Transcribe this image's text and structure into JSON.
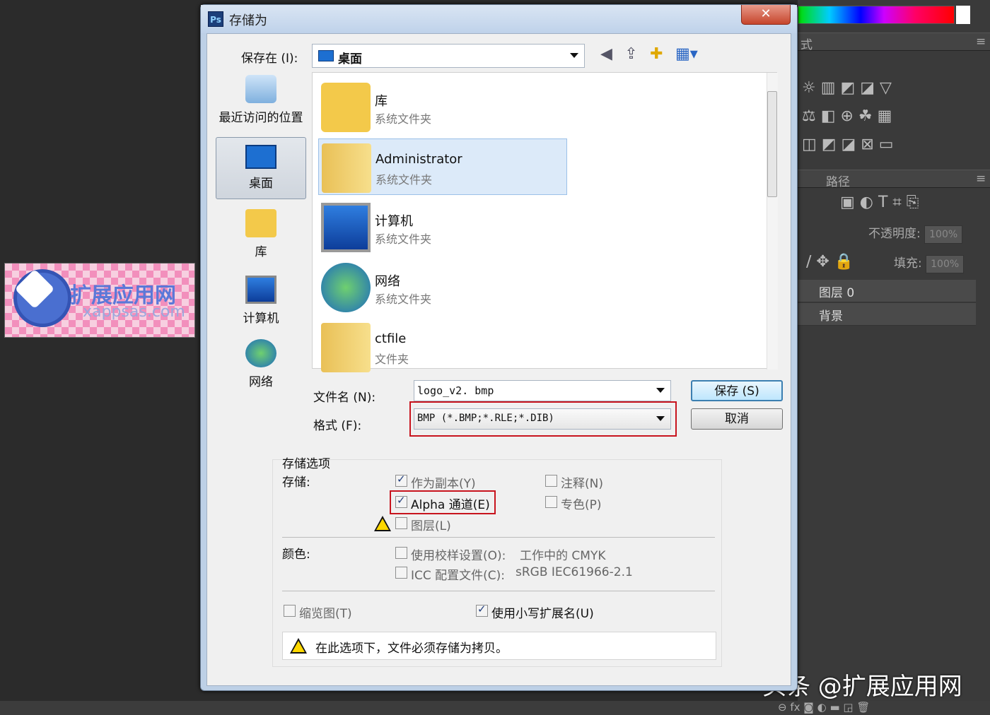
{
  "dialog": {
    "app_badge": "Ps",
    "title": "存储为",
    "close_label": "✕"
  },
  "save_in": {
    "label": "保存在 (I):",
    "value": "桌面"
  },
  "places": [
    {
      "label": "最近访问的位置"
    },
    {
      "label": "桌面"
    },
    {
      "label": "库"
    },
    {
      "label": "计算机"
    },
    {
      "label": "网络"
    }
  ],
  "files": [
    {
      "name": "库",
      "type": "系统文件夹"
    },
    {
      "name": "Administrator",
      "type": "系统文件夹"
    },
    {
      "name": "计算机",
      "type": "系统文件夹"
    },
    {
      "name": "网络",
      "type": "系统文件夹"
    },
    {
      "name": "ctfile",
      "type": "文件夹"
    }
  ],
  "filename": {
    "label": "文件名 (N):",
    "value": "logo_v2. bmp"
  },
  "format": {
    "label": "格式 (F):",
    "value": "BMP  (*.BMP;*.RLE;*.DIB)"
  },
  "buttons": {
    "save": "保存 (S)",
    "cancel": "取消"
  },
  "options": {
    "group_title": "存储选项",
    "store_label": "存储:",
    "as_copy": "作为副本(Y)",
    "notes": "注释(N)",
    "alpha": "Alpha 通道(E)",
    "spot": "专色(P)",
    "layers": "图层(L)",
    "color_label": "颜色:",
    "proof_label": "使用校样设置(O):",
    "proof_value": "工作中的 CMYK",
    "icc_label": "ICC 配置文件(C):",
    "icc_value": "sRGB IEC61966-2.1",
    "thumbnail": "缩览图(T)",
    "lowercase_ext": "使用小写扩展名(U)",
    "notice": "在此选项下，文件必须存储为拷贝。"
  },
  "checkboxes": {
    "as_copy": true,
    "notes": false,
    "alpha": true,
    "spot": false,
    "layers": false,
    "proof": false,
    "icc": false,
    "thumbnail": false,
    "lowercase_ext": true
  },
  "photoshop": {
    "tab_style_fragment": "式",
    "tab_paths": "路径",
    "opacity_label": "不透明度:",
    "opacity_value": "100%",
    "fill_label": "填充:",
    "fill_value": "100%",
    "layer_0": "图层 0",
    "layer_bg": "背景"
  },
  "logo": {
    "title": "扩展应用网",
    "subtitle": "xappsas.com"
  },
  "watermark": "头条 @扩展应用网",
  "colors": {
    "dialog_frame": "#bdd0e6",
    "highlight_red": "#c8141e",
    "selection": "#dceaf9"
  }
}
